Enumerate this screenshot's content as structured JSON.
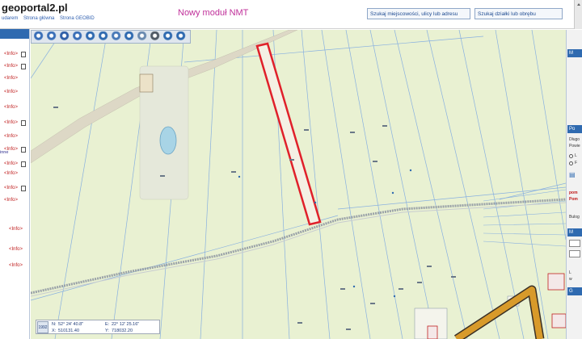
{
  "header": {
    "logo": "geoportal2.pl",
    "links": [
      "udarem",
      "Strona główna",
      "Strona GEOBID"
    ],
    "module_title": "Nowy moduł NMT",
    "search_address_label": "Szukaj miejscowości, ulicy lub adresu",
    "search_plot_label": "Szukaj działki lub obrębu"
  },
  "sidebar": {
    "info_label": "<Info>",
    "side_label": "inne"
  },
  "toolbar": {
    "tools": [
      "zoom-in-icon",
      "zoom-out-icon",
      "pan-hand-icon",
      "zoom-extent-icon",
      "back-arrow-icon",
      "forward-arrow-icon",
      "measure-icon",
      "info-icon",
      "layers-icon",
      "print-icon",
      "globe-icon",
      "camera-icon"
    ]
  },
  "map": {
    "highlight_color": "#e0202a",
    "road_color": "#d89a2a",
    "boundary_color": "#88b0e0"
  },
  "coords": {
    "epsg": "1992",
    "n_label": "N:",
    "n_value": "52° 24' 40.8\"",
    "e_label": "E:",
    "e_value": "22° 12' 25.16\"",
    "x_label": "X:",
    "x_value": "510131.40",
    "y_label": "Y:",
    "y_value": "718032.20"
  },
  "right_panel": {
    "head_1": "M",
    "head_2": "Po",
    "text_1": "Długo",
    "text_2": "Powie",
    "radio_1": "L",
    "radio_2": "F",
    "red_1": "pom",
    "red_2": "Pom",
    "text_3": "Bulog",
    "head_3": "M",
    "head_4": "G",
    "text_4": "L",
    "text_5": "w"
  }
}
